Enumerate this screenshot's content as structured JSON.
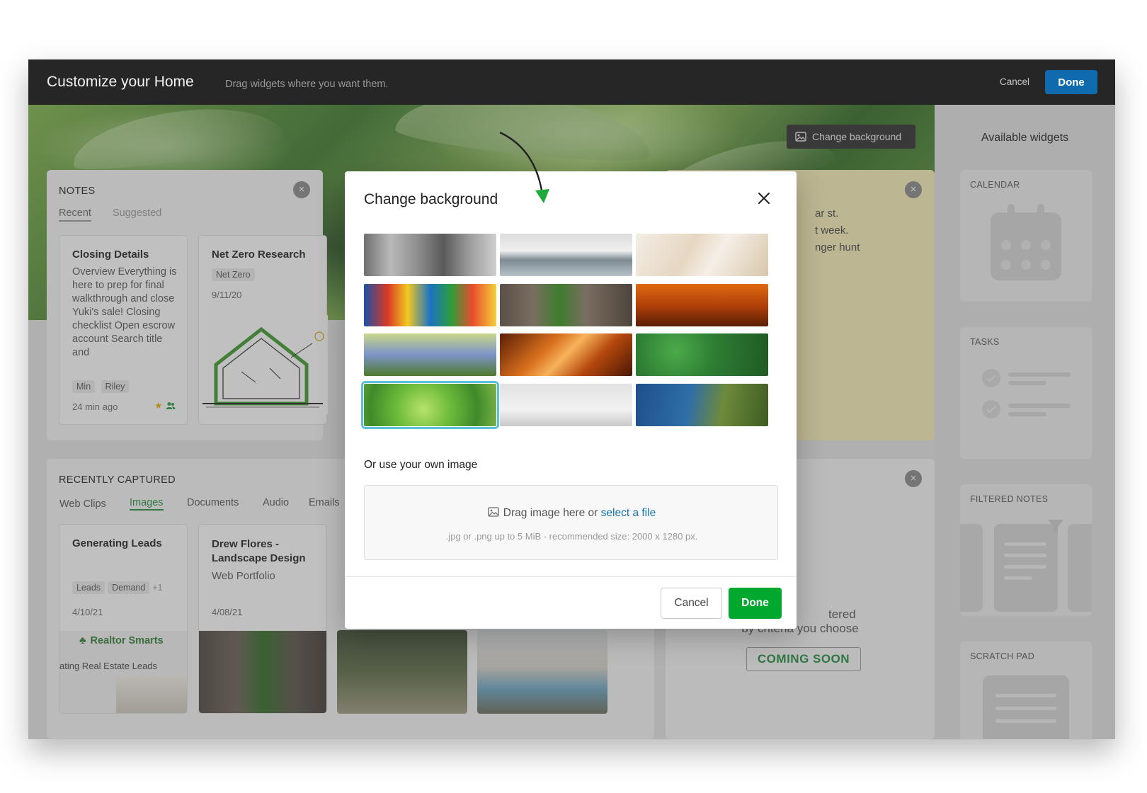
{
  "header": {
    "title": "Customize your Home",
    "subtitle": "Drag widgets where you want them.",
    "cancel_label": "Cancel",
    "done_label": "Done"
  },
  "hero": {
    "change_background_label": "Change background"
  },
  "notes_widget": {
    "title": "NOTES",
    "tabs": [
      "Recent",
      "Suggested"
    ],
    "cards": [
      {
        "title": "Closing Details",
        "body": "Overview Everything is here to prep for final walkthrough and close Yuki's sale! Closing checklist Open escrow account Search title and",
        "tags": [
          "Min",
          "Riley"
        ],
        "time": "24 min ago"
      },
      {
        "title": "Net Zero Research",
        "tags": [
          "Net Zero"
        ],
        "date": "9/11/20"
      }
    ]
  },
  "sticky_widget": {
    "lines": [
      "ar st.",
      "t week.",
      "nger hunt"
    ]
  },
  "recently_captured": {
    "title": "RECENTLY CAPTURED",
    "tabs": [
      "Web Clips",
      "Images",
      "Documents",
      "Audio",
      "Emails"
    ],
    "active_tab": "Images",
    "cards": [
      {
        "title": "Generating Leads",
        "tags": [
          "Leads",
          "Demand"
        ],
        "more": "+1",
        "date": "4/10/21",
        "thumb_brand": "Realtor Smarts",
        "thumb_caption": "ating Real Estate Leads"
      },
      {
        "title": "Drew Flores - Landscape Design",
        "subtitle": "Web Portfolio",
        "date": "4/08/21"
      }
    ]
  },
  "filtered_widget": {
    "line1": "tered",
    "line2": "by criteria you choose",
    "badge": "COMING SOON"
  },
  "available_widgets": {
    "title": "Available widgets",
    "items": [
      "CALENDAR",
      "TASKS",
      "FILTERED NOTES",
      "SCRATCH PAD"
    ]
  },
  "modal": {
    "title": "Change background",
    "own_image_label": "Or use your own image",
    "drop_text": "Drag image here or",
    "select_link": "select a file",
    "drop_hint": ".jpg or .png up to 5 MiB -  recommended size: 2000 x 1280 px.",
    "cancel_label": "Cancel",
    "done_label": "Done",
    "thumbnails": [
      {
        "name": "window-mug",
        "bg": "linear-gradient(90deg,#6f6f6f 0%,#b9b9b9 20%,#8f8f8f 40%,#5a5a5a 60%,#9d9d9d 80%,#cfcfcf 100%)"
      },
      {
        "name": "lake-pier",
        "bg": "linear-gradient(180deg,#dcdcdc 0%,#f0f0f0 40%,#7d8a92 62%,#b8c2c8 100%)"
      },
      {
        "name": "wheat-grass",
        "bg": "linear-gradient(120deg,#f3ede4 0%,#e6d7c2 40%,#f5efe7 60%,#d9c6ab 100%)"
      },
      {
        "name": "beach-huts",
        "bg": "linear-gradient(90deg,#1b4fa6 0%,#d93a25 18%,#f2c81f 33%,#1b73c4 50%,#2e9d3b 66%,#e84d2d 82%,#f4d03a 100%)"
      },
      {
        "name": "ivy-wood",
        "bg": "linear-gradient(90deg,#5a5047 0%,#7a6d61 25%,#3e7d2d 45%,#7a6d61 65%,#4d443c 100%)"
      },
      {
        "name": "sunset-bridge",
        "bg": "linear-gradient(180deg,#e06a10 0%,#b2410a 50%,#5a1e05 100%)"
      },
      {
        "name": "lupine-field",
        "bg": "linear-gradient(180deg,#c9d88a 0%,#7d93c9 50%,#4e7a2c 100%)"
      },
      {
        "name": "antelope-canyon",
        "bg": "linear-gradient(135deg,#5a1e05 0%,#d8701e 35%,#f7b25a 50%,#b4470d 70%,#4a1804 100%)"
      },
      {
        "name": "clover-field",
        "bg": "radial-gradient(circle at 30% 40%,#4cab4a 0%,#2e7e33 40%,#1f5a24 100%)"
      },
      {
        "name": "succulent",
        "bg": "radial-gradient(circle at 45% 60%,#b7e26a 0%,#6dbb3b 35%,#3f8a2a 70%,#7fb54a 100%)"
      },
      {
        "name": "bird-flight",
        "bg": "linear-gradient(180deg,#e2e2e2 0%,#f2f2f2 60%,#c9c9c9 100%)"
      },
      {
        "name": "coast-cliff",
        "bg": "linear-gradient(100deg,#1e4f8c 0%,#2f6ea8 40%,#6e8a3b 65%,#3d5c22 100%)"
      }
    ]
  },
  "colors": {
    "topbar": "#262626",
    "primary_blue": "#0f6bae",
    "green": "#00a82d",
    "link": "#1273b6"
  }
}
